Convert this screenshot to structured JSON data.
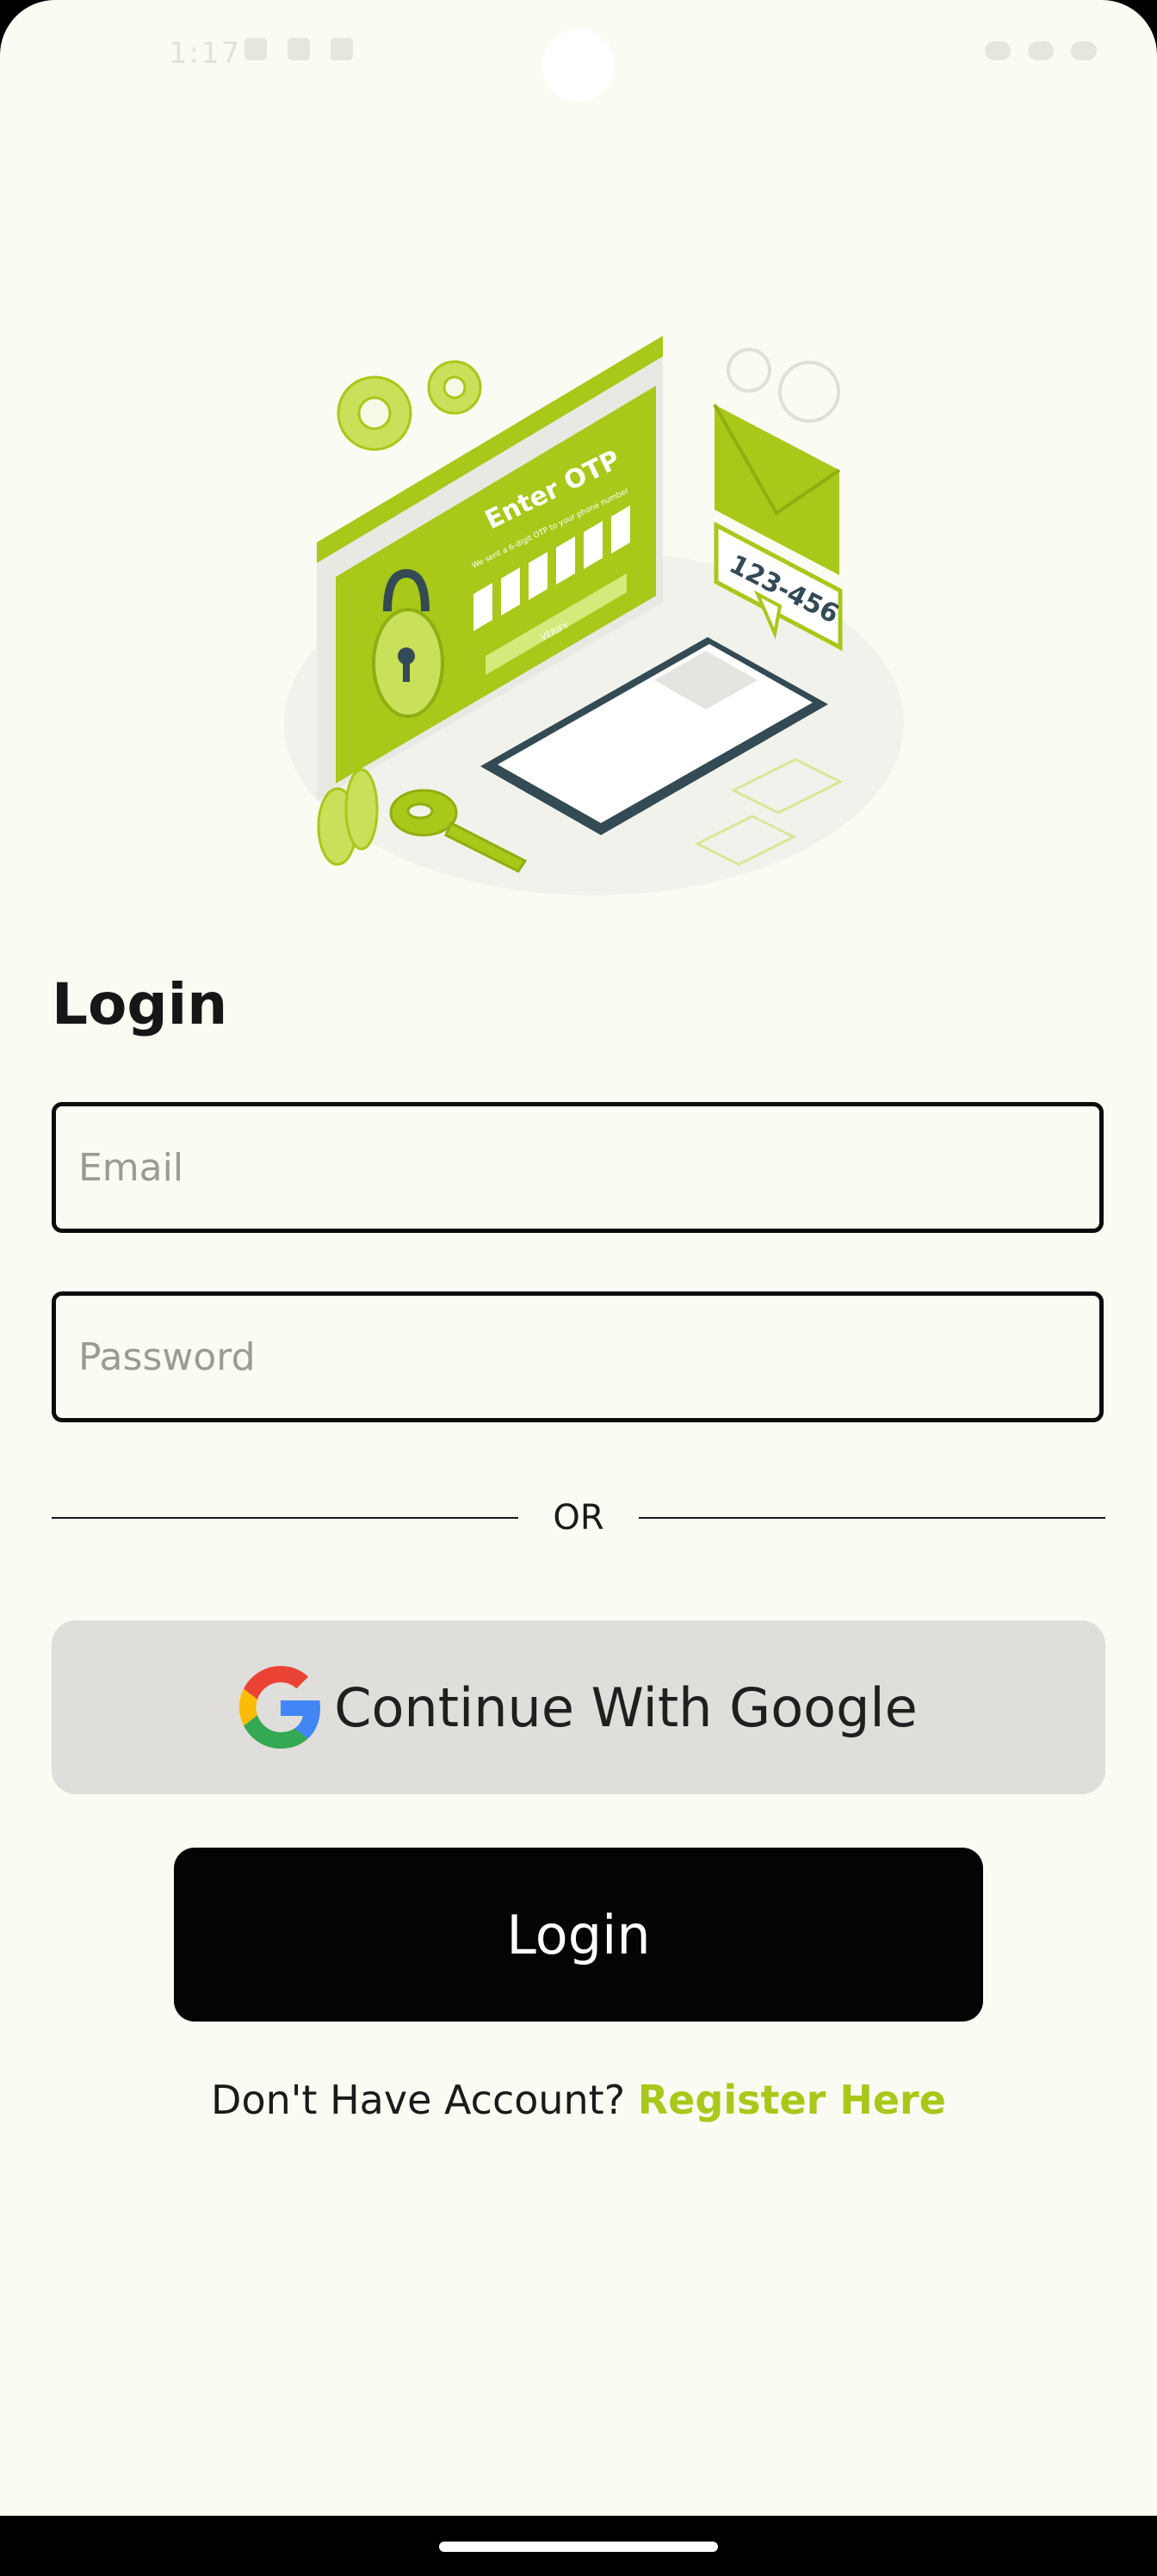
{
  "status_bar": {
    "time": "1:17"
  },
  "illustration": {
    "screen_title": "Enter OTP",
    "screen_subtitle": "We sent a 6-digit OTP to your phone number",
    "verify_label": "VERIFY",
    "code_label": "123-456"
  },
  "login_form": {
    "title": "Login",
    "email_placeholder": "Email",
    "email_value": "",
    "password_placeholder": "Password",
    "password_value": "",
    "divider_text": "OR",
    "google_button_label": "Continue With Google",
    "login_button_label": "Login",
    "register_prompt": "Don't Have Account?",
    "register_link": "Register Here"
  },
  "colors": {
    "background": "#fbfbf3",
    "accent": "#a8c81a",
    "google_button_bg": "#dfdeda",
    "login_button_bg": "#050304"
  },
  "icons": {
    "google": "google-g-icon"
  }
}
